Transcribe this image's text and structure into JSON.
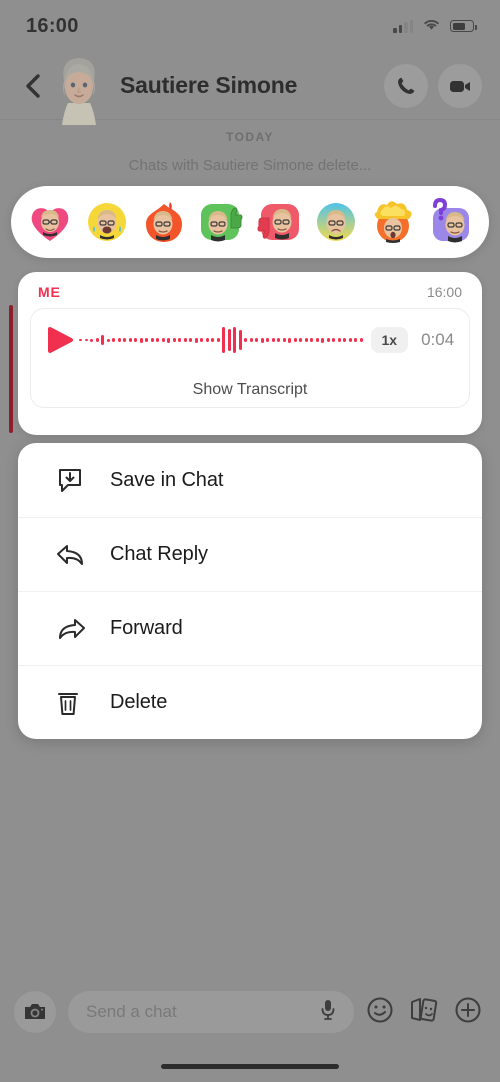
{
  "status_bar": {
    "time": "16:00",
    "signal_icon": "cell-signal-icon",
    "wifi_icon": "wifi-icon",
    "battery_icon": "battery-icon"
  },
  "header": {
    "back_icon": "back-chevron-icon",
    "avatar_icon": "contact-bitmoji-avatar",
    "title": "Sautiere Simone",
    "call_icon": "phone-call-icon",
    "video_icon": "video-call-icon"
  },
  "conversation": {
    "day_divider": "TODAY",
    "system_note": "Chats with Sautiere Simone delete..."
  },
  "reactions": {
    "items": [
      {
        "name": "reaction-heart",
        "icon": "heart-bitmoji-icon",
        "color": "#ef4a7f"
      },
      {
        "name": "reaction-laugh",
        "icon": "laughing-bitmoji-icon",
        "color": "#f5d73a"
      },
      {
        "name": "reaction-fire",
        "icon": "fire-bitmoji-icon",
        "color": "#f4542a"
      },
      {
        "name": "reaction-thumbs-up",
        "icon": "thumbs-up-bitmoji-icon",
        "color": "#5fc35b"
      },
      {
        "name": "reaction-thumbs-down",
        "icon": "thumbs-down-bitmoji-icon",
        "color": "#ef5a6a"
      },
      {
        "name": "reaction-sad",
        "icon": "sad-bitmoji-icon",
        "color": "#4ec3e8"
      },
      {
        "name": "reaction-mind-blown",
        "icon": "mind-blown-bitmoji-icon",
        "color": "#f7a93b"
      },
      {
        "name": "reaction-question",
        "icon": "question-bitmoji-icon",
        "color": "#9b87e8"
      }
    ]
  },
  "voice_message": {
    "sender": "ME",
    "timestamp": "16:00",
    "play_icon": "play-icon",
    "speed": "1x",
    "duration": "0:04",
    "transcript_label": "Show Transcript",
    "accent_color": "#f1304f",
    "reply_bar_color": "#8c1f2c",
    "waveform": [
      2,
      2,
      3,
      4,
      10,
      3,
      4,
      4,
      4,
      4,
      4,
      5,
      4,
      4,
      4,
      4,
      5,
      4,
      4,
      4,
      4,
      5,
      4,
      4,
      4,
      4,
      26,
      22,
      26,
      20,
      4,
      4,
      4,
      5,
      4,
      4,
      4,
      4,
      5,
      4,
      4,
      4,
      4,
      4,
      5,
      4,
      4,
      4,
      4,
      4,
      4,
      4
    ]
  },
  "context_menu": {
    "items": [
      {
        "label": "Save in Chat",
        "icon": "save-in-chat-icon",
        "name": "menu-item-save-in-chat"
      },
      {
        "label": "Chat Reply",
        "icon": "reply-arrow-icon",
        "name": "menu-item-chat-reply"
      },
      {
        "label": "Forward",
        "icon": "forward-arrow-icon",
        "name": "menu-item-forward"
      },
      {
        "label": "Delete",
        "icon": "trash-icon",
        "name": "menu-item-delete"
      }
    ]
  },
  "bottom_bar": {
    "camera_icon": "camera-icon",
    "input_placeholder": "Send a chat",
    "input_value": "",
    "mic_icon": "microphone-icon",
    "emoji_icon": "smiley-face-icon",
    "stickers_icon": "stickers-cards-icon",
    "add_icon": "plus-circle-icon"
  }
}
